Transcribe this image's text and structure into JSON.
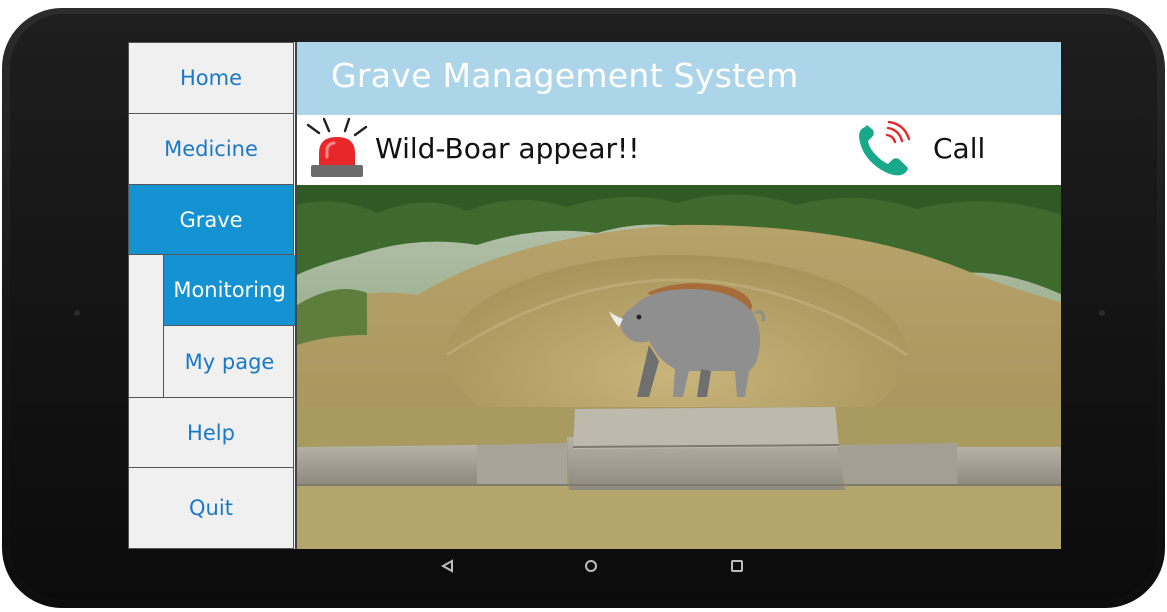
{
  "app": {
    "title": "Grave Management System"
  },
  "sidebar": {
    "items": [
      {
        "label": "Home"
      },
      {
        "label": "Medicine"
      },
      {
        "label": "Grave"
      },
      {
        "label": "Help"
      },
      {
        "label": "Quit"
      }
    ],
    "sub_items": [
      {
        "label": "Monitoring"
      },
      {
        "label": "My page"
      }
    ]
  },
  "alert": {
    "message": "Wild-Boar appear!!",
    "call_label": "Call"
  },
  "icons": {
    "alarm": "siren-icon",
    "call": "phone-ringing-icon",
    "boar": "wild-boar-icon",
    "nav_back": "back-triangle-icon",
    "nav_home": "home-circle-icon",
    "nav_recent": "recent-apps-icon"
  },
  "colors": {
    "active_nav": "#1592d2",
    "nav_text": "#1a78c8",
    "header_bg": "#add5ea",
    "siren_red": "#e8272a",
    "phone_green": "#18a88a"
  }
}
